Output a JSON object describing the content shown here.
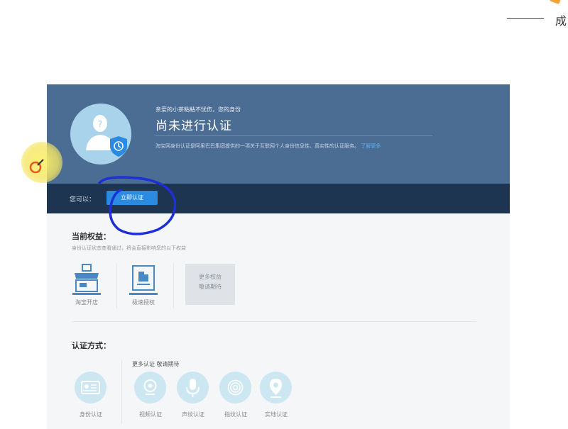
{
  "slide": {
    "corner_text": "成",
    "header_text": "... ..."
  },
  "banner": {
    "notice": "亲爱的小茶粘粘不忧伤，您的身份",
    "status_title": "尚未进行认证",
    "description": "淘宝网身份认证是阿里巴巴集团提供的一项关于互联网个人身份信息性、真实性的认证服务。",
    "learn_more": "了解更多"
  },
  "action_bar": {
    "label": "您可以：",
    "verify_button": "立即认证"
  },
  "rights": {
    "title": "当前权益：",
    "subtitle": "身份认证状态查看通过，将会直接影响您的以下权益",
    "items": [
      {
        "label": "淘宝开店",
        "icon": "shop-icon"
      },
      {
        "label": "极速授权",
        "icon": "fast-authorize-icon"
      }
    ],
    "more_line1": "更多权益",
    "more_line2": "敬请期待"
  },
  "methods": {
    "title": "认证方式：",
    "more_label": "更多认证 敬请期待",
    "items": [
      {
        "label": "身份认证",
        "icon": "id-card-icon"
      },
      {
        "label": "视频认证",
        "icon": "video-camera-icon"
      },
      {
        "label": "声纹认证",
        "icon": "microphone-icon"
      },
      {
        "label": "指纹认证",
        "icon": "fingerprint-icon"
      },
      {
        "label": "实地认证",
        "icon": "location-pin-icon"
      }
    ]
  },
  "colors": {
    "banner": "#4c6d93",
    "action_bar": "#1d3550",
    "button": "#2b8be0",
    "method_circle": "#cde7f2",
    "annotation": "#1e2fd6"
  }
}
